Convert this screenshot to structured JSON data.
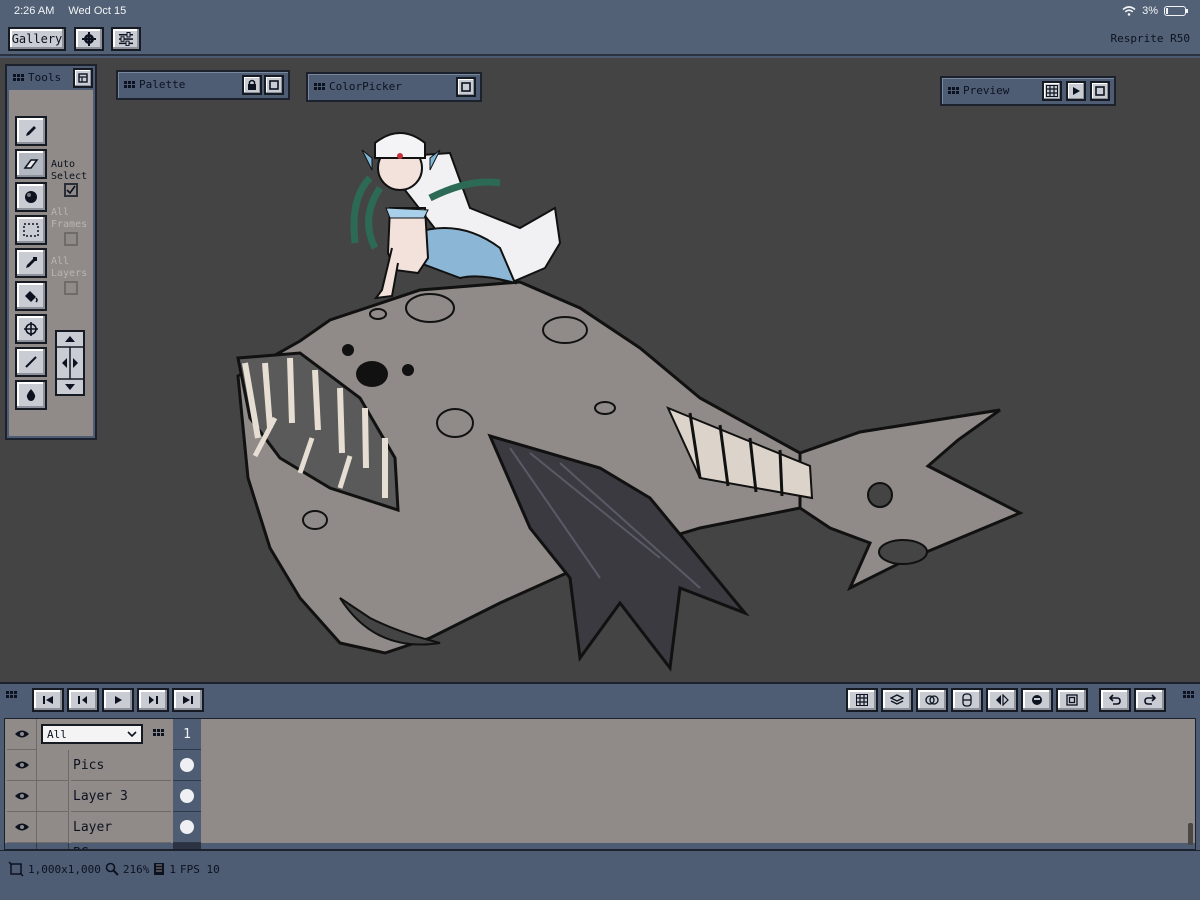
{
  "status_bar": {
    "time": "2:26 AM",
    "date": "Wed Oct 15",
    "battery": "3%"
  },
  "app_toolbar": {
    "gallery_label": "Gallery",
    "app_title": "Resprite R50"
  },
  "panels": {
    "palette_title": "Palette",
    "colorpicker_title": "ColorPicker",
    "preview_title": "Preview"
  },
  "tools": {
    "title": "Tools",
    "auto_select_label": "Auto Select",
    "auto_select_checked": true,
    "all_frames_label": "All Frames",
    "all_layers_label": "All Layers"
  },
  "timeline": {
    "filter_value": "All",
    "frame_number": "1",
    "layers": [
      {
        "name": "Pics"
      },
      {
        "name": "Layer 3"
      },
      {
        "name": "Layer"
      },
      {
        "name": "BG"
      }
    ]
  },
  "bottom_status": {
    "canvas_size": "1,000x1,000",
    "zoom": "216%",
    "frames": "1",
    "fps": "FPS 10"
  },
  "colors": {
    "canvas": "#444444",
    "ui_bg": "#4e5d74",
    "button": "#c9ccd2",
    "layer_bg": "#908b88",
    "fish_body": "#908b88"
  }
}
